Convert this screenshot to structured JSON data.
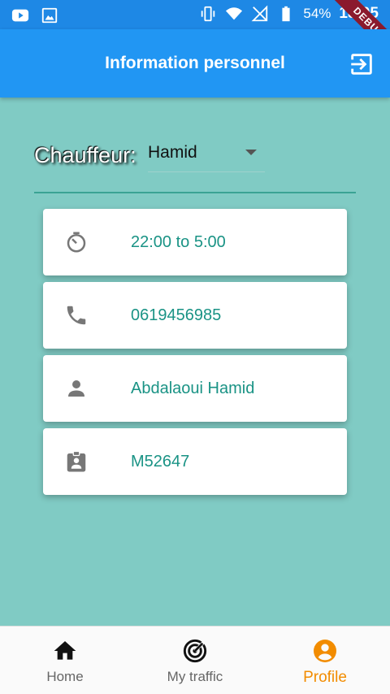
{
  "status_bar": {
    "battery": "54%",
    "time": "18:05",
    "icons": [
      "youtube-icon",
      "image-icon",
      "vibrate-icon",
      "wifi-icon",
      "no-signal-icon",
      "battery-icon"
    ]
  },
  "debug_banner": "DEBUG",
  "app_bar": {
    "title": "Information personnel",
    "action_icon": "logout-icon"
  },
  "driver": {
    "label": "Chauffeur:",
    "selected": "Hamid"
  },
  "cards": [
    {
      "icon": "timer-icon",
      "text": "22:00 to 5:00"
    },
    {
      "icon": "phone-icon",
      "text": "0619456985"
    },
    {
      "icon": "person-icon",
      "text": "Abdalaoui Hamid"
    },
    {
      "icon": "badge-icon",
      "text": "M52647"
    }
  ],
  "bottom_nav": {
    "items": [
      {
        "label": "Home",
        "icon": "home-icon",
        "active": false
      },
      {
        "label": "My traffic",
        "icon": "radar-icon",
        "active": false
      },
      {
        "label": "Profile",
        "icon": "account-circle-icon",
        "active": true
      }
    ]
  },
  "colors": {
    "app_bar": "#2196f3",
    "background": "#80cbc4",
    "accent_text": "#1a9385",
    "active_nav": "#f28c00"
  }
}
